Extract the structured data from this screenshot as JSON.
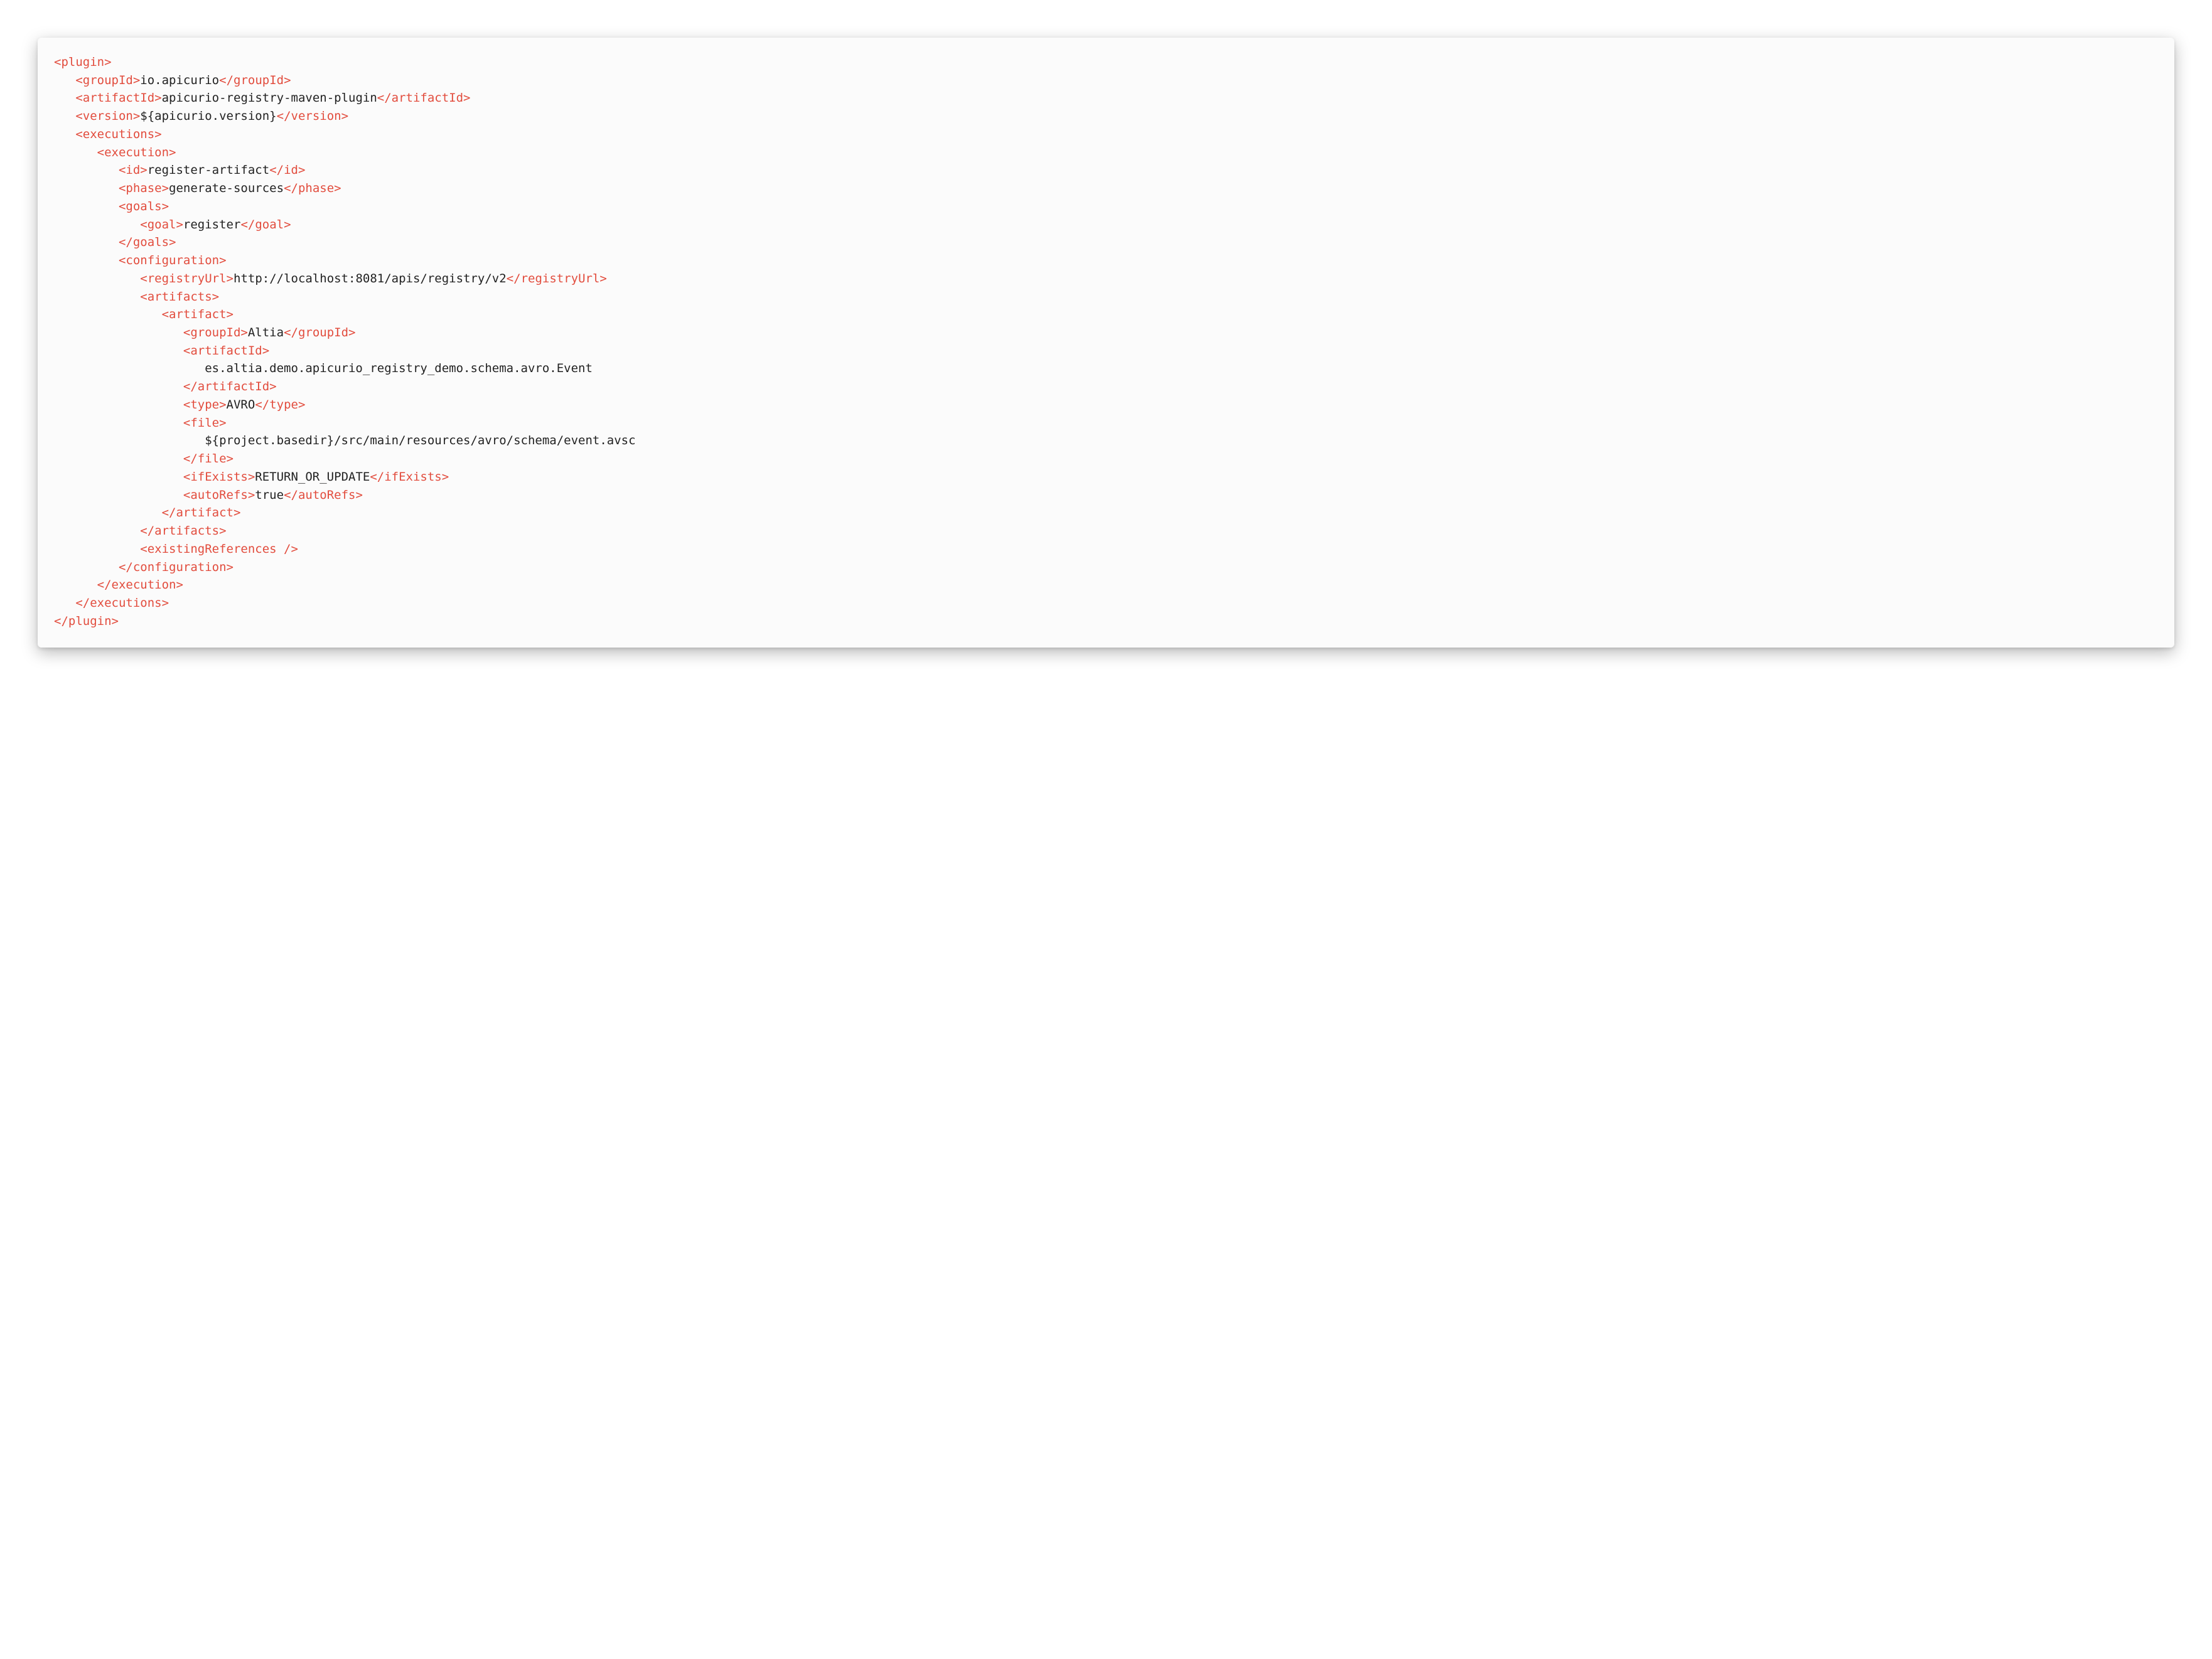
{
  "colors": {
    "tag": "#e24c3d",
    "text": "#222222",
    "boxBackground": "#fbfbfb"
  },
  "indent": "   ",
  "lines": [
    {
      "depth": 0,
      "parts": [
        {
          "type": "tag",
          "text": "<plugin>"
        }
      ]
    },
    {
      "depth": 1,
      "parts": [
        {
          "type": "tag",
          "text": "<groupId>"
        },
        {
          "type": "val",
          "text": "io.apicurio"
        },
        {
          "type": "tag",
          "text": "</groupId>"
        }
      ]
    },
    {
      "depth": 1,
      "parts": [
        {
          "type": "tag",
          "text": "<artifactId>"
        },
        {
          "type": "val",
          "text": "apicurio-registry-maven-plugin"
        },
        {
          "type": "tag",
          "text": "</artifactId>"
        }
      ]
    },
    {
      "depth": 1,
      "parts": [
        {
          "type": "tag",
          "text": "<version>"
        },
        {
          "type": "val",
          "text": "${apicurio.version}"
        },
        {
          "type": "tag",
          "text": "</version>"
        }
      ]
    },
    {
      "depth": 1,
      "parts": [
        {
          "type": "tag",
          "text": "<executions>"
        }
      ]
    },
    {
      "depth": 2,
      "parts": [
        {
          "type": "tag",
          "text": "<execution>"
        }
      ]
    },
    {
      "depth": 3,
      "parts": [
        {
          "type": "tag",
          "text": "<id>"
        },
        {
          "type": "val",
          "text": "register-artifact"
        },
        {
          "type": "tag",
          "text": "</id>"
        }
      ]
    },
    {
      "depth": 3,
      "parts": [
        {
          "type": "tag",
          "text": "<phase>"
        },
        {
          "type": "val",
          "text": "generate-sources"
        },
        {
          "type": "tag",
          "text": "</phase>"
        }
      ]
    },
    {
      "depth": 3,
      "parts": [
        {
          "type": "tag",
          "text": "<goals>"
        }
      ]
    },
    {
      "depth": 4,
      "parts": [
        {
          "type": "tag",
          "text": "<goal>"
        },
        {
          "type": "val",
          "text": "register"
        },
        {
          "type": "tag",
          "text": "</goal>"
        }
      ]
    },
    {
      "depth": 3,
      "parts": [
        {
          "type": "tag",
          "text": "</goals>"
        }
      ]
    },
    {
      "depth": 3,
      "parts": [
        {
          "type": "tag",
          "text": "<configuration>"
        }
      ]
    },
    {
      "depth": 4,
      "parts": [
        {
          "type": "tag",
          "text": "<registryUrl>"
        },
        {
          "type": "val",
          "text": "http://localhost:8081/apis/registry/v2"
        },
        {
          "type": "tag",
          "text": "</registryUrl>"
        }
      ]
    },
    {
      "depth": 4,
      "parts": [
        {
          "type": "tag",
          "text": "<artifacts>"
        }
      ]
    },
    {
      "depth": 5,
      "parts": [
        {
          "type": "tag",
          "text": "<artifact>"
        }
      ]
    },
    {
      "depth": 6,
      "parts": [
        {
          "type": "tag",
          "text": "<groupId>"
        },
        {
          "type": "val",
          "text": "Altia"
        },
        {
          "type": "tag",
          "text": "</groupId>"
        }
      ]
    },
    {
      "depth": 6,
      "parts": [
        {
          "type": "tag",
          "text": "<artifactId>"
        }
      ]
    },
    {
      "depth": 7,
      "parts": [
        {
          "type": "val",
          "text": "es.altia.demo.apicurio_registry_demo.schema.avro.Event"
        }
      ]
    },
    {
      "depth": 6,
      "parts": [
        {
          "type": "tag",
          "text": "</artifactId>"
        }
      ]
    },
    {
      "depth": 6,
      "parts": [
        {
          "type": "tag",
          "text": "<type>"
        },
        {
          "type": "val",
          "text": "AVRO"
        },
        {
          "type": "tag",
          "text": "</type>"
        }
      ]
    },
    {
      "depth": 6,
      "parts": [
        {
          "type": "tag",
          "text": "<file>"
        }
      ]
    },
    {
      "depth": 7,
      "parts": [
        {
          "type": "val",
          "text": "${project.basedir}/src/main/resources/avro/schema/event.avsc"
        }
      ]
    },
    {
      "depth": 6,
      "parts": [
        {
          "type": "tag",
          "text": "</file>"
        }
      ]
    },
    {
      "depth": 6,
      "parts": [
        {
          "type": "tag",
          "text": "<ifExists>"
        },
        {
          "type": "val",
          "text": "RETURN_OR_UPDATE"
        },
        {
          "type": "tag",
          "text": "</ifExists>"
        }
      ]
    },
    {
      "depth": 6,
      "parts": [
        {
          "type": "tag",
          "text": "<autoRefs>"
        },
        {
          "type": "val",
          "text": "true"
        },
        {
          "type": "tag",
          "text": "</autoRefs>"
        }
      ]
    },
    {
      "depth": 5,
      "parts": [
        {
          "type": "tag",
          "text": "</artifact>"
        }
      ]
    },
    {
      "depth": 4,
      "parts": [
        {
          "type": "tag",
          "text": "</artifacts>"
        }
      ]
    },
    {
      "depth": 4,
      "parts": [
        {
          "type": "tag",
          "text": "<existingReferences />"
        }
      ]
    },
    {
      "depth": 3,
      "parts": [
        {
          "type": "tag",
          "text": "</configuration>"
        }
      ]
    },
    {
      "depth": 2,
      "parts": [
        {
          "type": "tag",
          "text": "</execution>"
        }
      ]
    },
    {
      "depth": 1,
      "parts": [
        {
          "type": "tag",
          "text": "</executions>"
        }
      ]
    },
    {
      "depth": 0,
      "parts": [
        {
          "type": "tag",
          "text": "</plugin>"
        }
      ]
    }
  ]
}
